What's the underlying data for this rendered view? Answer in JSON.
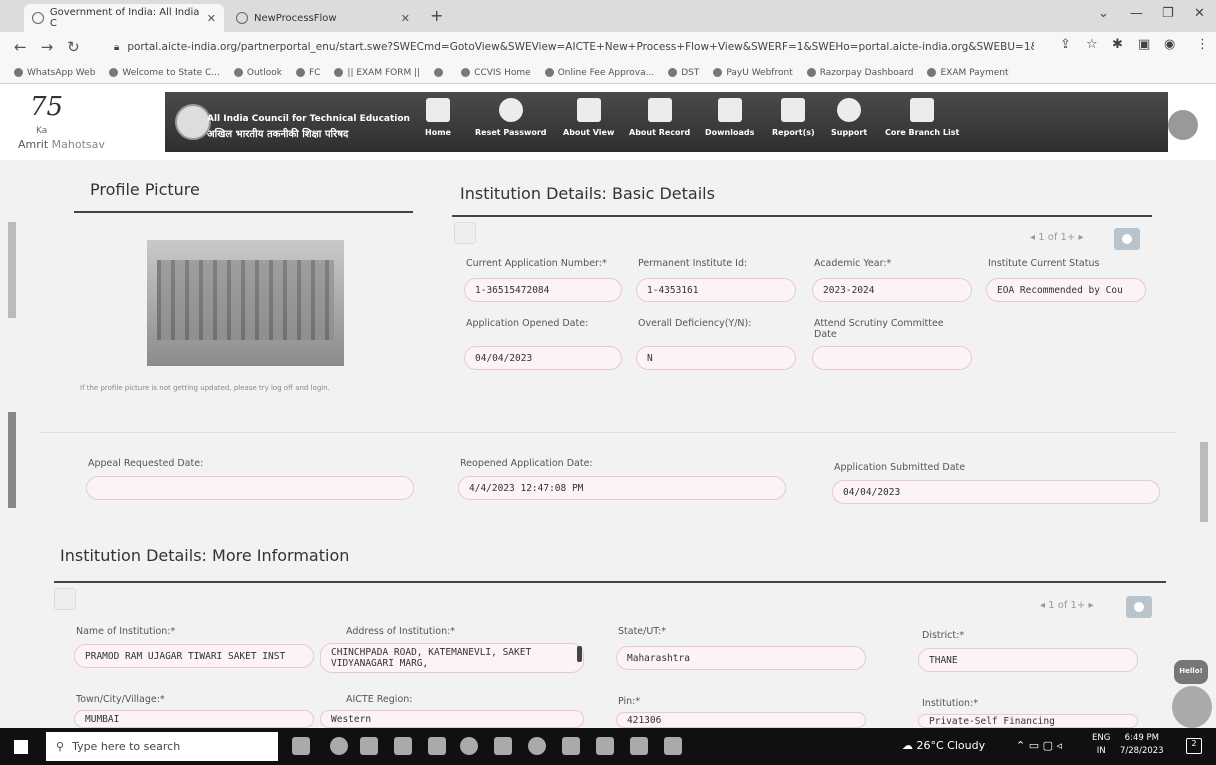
{
  "browser": {
    "tabs": [
      {
        "label": "Government of India: All India C"
      },
      {
        "label": "NewProcessFlow"
      }
    ],
    "new_tab": "+",
    "url": "portal.aicte-india.org/partnerportal_enu/start.swe?SWECmd=GotoView&SWEView=AICTE+New+Process+Flow+View&SWERF=1&SWEHo=portal.aicte-india.org&SWEBU=1&...",
    "bookmarks": [
      "WhatsApp Web",
      "Welcome to State C...",
      "Outlook",
      "FC",
      "|| EXAM FORM ||",
      "",
      "CCVIS Home",
      "Online Fee Approva...",
      "DST",
      "PayU Webfront",
      "Razorpay Dashboard",
      "EXAM Payment"
    ]
  },
  "header": {
    "azadi_75": "75",
    "azadi_line1": "Ka",
    "azadi_line2a": "Amrit ",
    "azadi_line2b": "Mahotsav",
    "org_en": "All India Council for Technical Education",
    "org_hi": "अखिल भारतीय तकनीकी शिक्षा परिषद",
    "nav": [
      "Home",
      "Reset Password",
      "About View",
      "About Record",
      "Downloads",
      "Report(s)",
      "Support",
      "Core Branch List"
    ]
  },
  "profile": {
    "title": "Profile Picture",
    "note": "If the profile picture is not getting updated, please try log off and login."
  },
  "basic": {
    "title": "Institution Details: Basic Details",
    "pager": "1 of 1+",
    "fields": [
      {
        "label": "Current Application Number:*",
        "value": "1-36515472084"
      },
      {
        "label": "Permanent Institute Id:",
        "value": "1-4353161"
      },
      {
        "label": "Academic Year:*",
        "value": "2023-2024"
      },
      {
        "label": "Institute Current Status",
        "value": "EOA Recommended by Cou"
      },
      {
        "label": "Application Opened Date:",
        "value": "04/04/2023"
      },
      {
        "label": "Overall Deficiency(Y/N):",
        "value": "N"
      },
      {
        "label": "Attend Scrutiny Committee Date",
        "value": ""
      }
    ]
  },
  "dates": {
    "appeal_label": "Appeal Requested Date:",
    "appeal_value": "",
    "reopened_label": "Reopened Application Date:",
    "reopened_value": "4/4/2023 12:47:08 PM",
    "submitted_label": "Application Submitted Date",
    "submitted_value": "04/04/2023"
  },
  "more": {
    "title": "Institution Details: More Information",
    "pager": "1 of 1+",
    "fields": [
      {
        "label": "Name of Institution:*",
        "value": "PRAMOD RAM UJAGAR TIWARI SAKET INST"
      },
      {
        "label": "Address of Institution:*",
        "value": "CHINCHPADA ROAD, KATEMANEVLI, SAKET VIDYANAGARI MARG,"
      },
      {
        "label": "State/UT:*",
        "value": "Maharashtra"
      },
      {
        "label": "District:*",
        "value": "THANE"
      },
      {
        "label": "Town/City/Village:*",
        "value": "MUMBAI"
      },
      {
        "label": "AICTE Region:",
        "value": "Western"
      },
      {
        "label": "Pin:*",
        "value": "421306"
      },
      {
        "label": "Institution:*",
        "value": "Private-Self Financing"
      }
    ]
  },
  "chat": {
    "hello": "Hello!"
  },
  "taskbar": {
    "search_placeholder": "Type here to search",
    "weather": "26°C  Cloudy",
    "lang": "ENG",
    "region": "IN",
    "time": "6:49 PM",
    "date": "7/28/2023",
    "notif_count": "2"
  }
}
